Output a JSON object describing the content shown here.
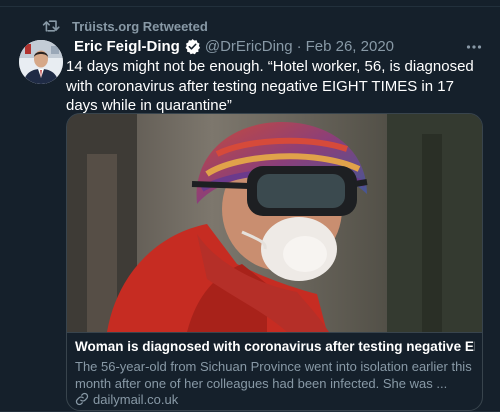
{
  "retweet": {
    "icon": "retweet-icon",
    "label": "Trüists.org Retweeted"
  },
  "tweet": {
    "author_name": "Eric Feigl-Ding",
    "verified_icon": "verified-badge-icon",
    "handle": "@DrEricDing",
    "separator": "·",
    "date": "Feb 26, 2020",
    "more_icon": "more-options-icon",
    "text": "14 days might not be enough. “Hotel worker, 56, is diagnosed with coronavirus after testing negative EIGHT TIMES in 17 days while in quarantine”"
  },
  "card": {
    "image_description_icon": "article-photo",
    "title": "Woman is diagnosed with coronavirus after testing negative EIGHT TI...",
    "description": "The 56-year-old from Sichuan Province went into isolation earlier this month after one of her colleagues had been infected. She was ...",
    "link_icon": "link-icon",
    "domain": "dailymail.co.uk"
  },
  "colors": {
    "background": "#15202b",
    "secondary_text": "#8899a6",
    "border": "#38444d",
    "verified": "#1da1f2"
  }
}
